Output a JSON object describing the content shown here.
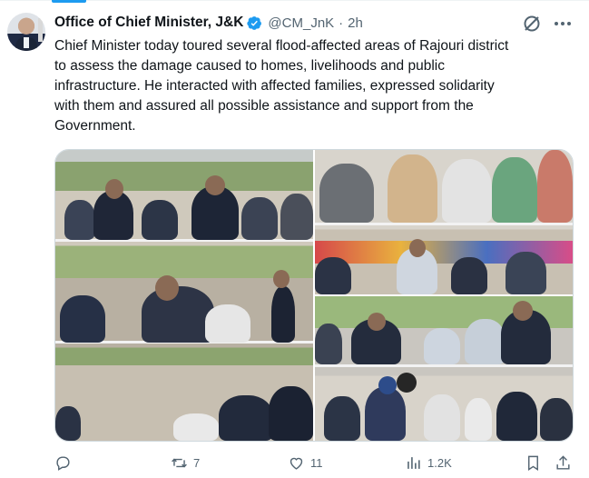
{
  "tweet": {
    "author_name": "Office of Chief Minister, J&K",
    "handle": "@CM_JnK",
    "separator": "·",
    "time": "2h",
    "text": "Chief Minister today toured several flood-affected areas of Rajouri district\nto assess the damage caused to homes, livelihoods and public\ninfrastructure. He interacted with affected families, expressed solidarity\nwith them and assured all possible assistance and support from the\nGovernment."
  },
  "actions": {
    "replies": "",
    "reposts": "7",
    "likes": "11",
    "views": "1.2K"
  },
  "icons": {
    "verified": "verified-badge-icon",
    "grok": "grok-icon",
    "more": "more-icon",
    "reply": "reply-icon",
    "repost": "repost-icon",
    "like": "heart-icon",
    "views": "views-icon",
    "bookmark": "bookmark-icon",
    "share": "share-icon"
  },
  "colors": {
    "verified_badge": "#1d9bf0",
    "handle_gray": "#536471",
    "border": "#cfd9de"
  }
}
